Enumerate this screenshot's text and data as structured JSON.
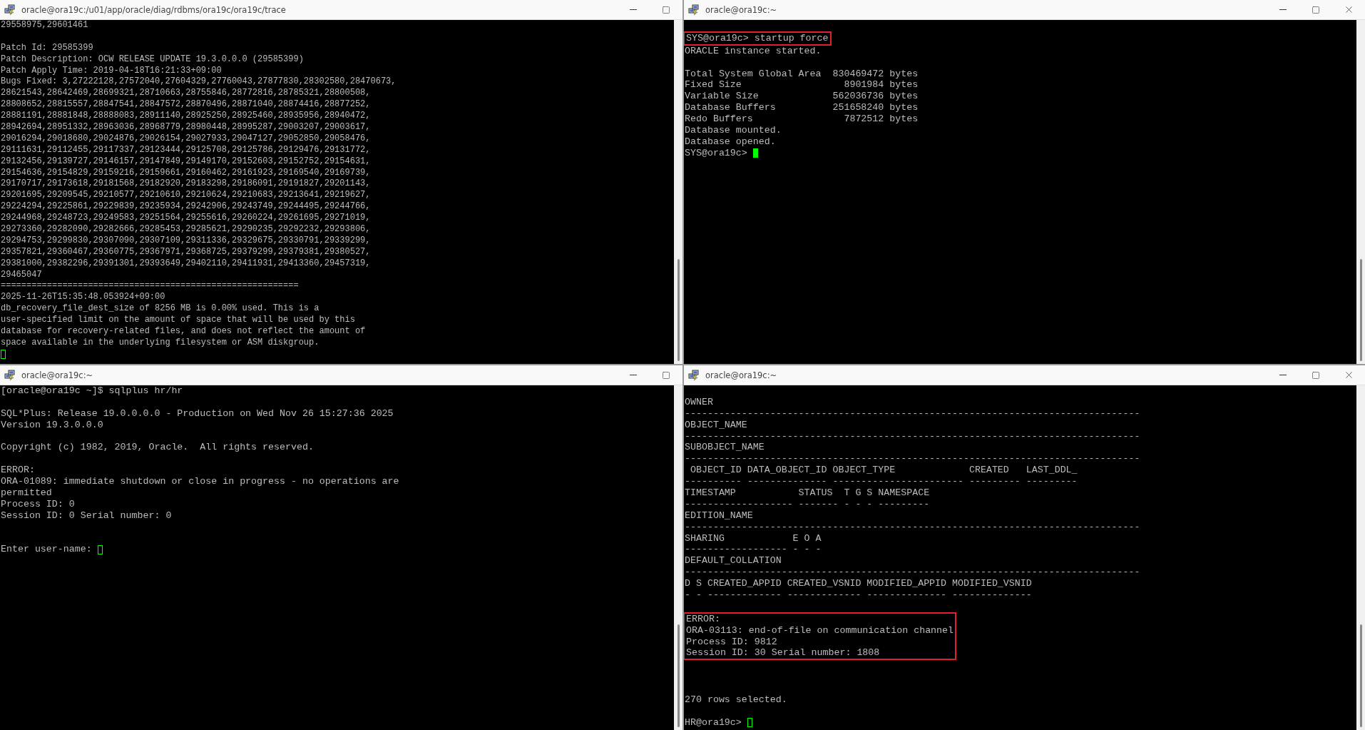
{
  "windows": [
    {
      "title": "oracle@ora19c:/u01/app/oracle/diag/rdbms/ora19c/ora19c/trace",
      "controls": [
        {
          "kind": "minimize"
        },
        {
          "kind": "maximize"
        }
      ],
      "blocks": [
        {
          "kind": "text",
          "lines": [
            "29558975,29601461"
          ]
        },
        {
          "kind": "blank"
        },
        {
          "kind": "text",
          "lines": [
            "Patch Id: 29585399",
            "Patch Description: OCW RELEASE UPDATE 19.3.0.0.0 (29585399)",
            "Patch Apply Time: 2019-04-18T16:21:33+09:00",
            "Bugs Fixed: 3,27222128,27572040,27604329,27760043,27877830,28302580,28470673,",
            "28621543,28642469,28699321,28710663,28755846,28772816,28785321,28800508,",
            "28808652,28815557,28847541,28847572,28870496,28871040,28874416,28877252,",
            "28881191,28881848,28888083,28911140,28925250,28925460,28935956,28940472,",
            "28942694,28951332,28963036,28968779,28980448,28995287,29003207,29003617,",
            "29016294,29018680,29024876,29026154,29027933,29047127,29052850,29058476,",
            "29111631,29112455,29117337,29123444,29125708,29125786,29129476,29131772,",
            "29132456,29139727,29146157,29147849,29149170,29152603,29152752,29154631,",
            "29154636,29154829,29159216,29159661,29160462,29161923,29169540,29169739,",
            "29170717,29173618,29181568,29182920,29183298,29186091,29191827,29201143,",
            "29201695,29209545,29210577,29210610,29210624,29210683,29213641,29219627,",
            "29224294,29225861,29229839,29235934,29242906,29243749,29244495,29244766,",
            "29244968,29248723,29249583,29251564,29255616,29260224,29261695,29271019,",
            "29273360,29282090,29282666,29285453,29285621,29290235,29292232,29293806,",
            "29294753,29299830,29307090,29307109,29311336,29329675,29330791,29339299,",
            "29357821,29360467,29360775,29367971,29368725,29379299,29379381,29380527,",
            "29381000,29382296,29391301,29393649,29402110,29411931,29413360,29457319,",
            "29465047",
            "==========================================================",
            "2025-11-26T15:35:48.053924+09:00",
            "db_recovery_file_dest_size of 8256 MB is 0.00% used. This is a",
            "user-specified limit on the amount of space that will be used by this",
            "database for recovery-related files, and does not reflect the amount of",
            "space available in the underlying filesystem or ASM diskgroup."
          ]
        },
        {
          "kind": "prompt",
          "focused": false
        }
      ]
    },
    {
      "title": "oracle@ora19c:~",
      "controls": [
        {
          "kind": "minimize"
        },
        {
          "kind": "maximize"
        },
        {
          "kind": "close"
        }
      ],
      "blocks": [
        {
          "kind": "blank"
        },
        {
          "kind": "highlight",
          "lines": [
            "SYS@ora19c> startup force"
          ]
        },
        {
          "kind": "text",
          "lines": [
            "ORACLE instance started."
          ]
        },
        {
          "kind": "blank"
        },
        {
          "kind": "text",
          "lines": [
            "Total System Global Area  830469472 bytes",
            "Fixed Size                  8901984 bytes",
            "Variable Size             562036736 bytes",
            "Database Buffers          251658240 bytes",
            "Redo Buffers                7872512 bytes",
            "Database mounted.",
            "Database opened."
          ]
        },
        {
          "kind": "prompt",
          "prompt": "SYS@ora19c>",
          "focused": true
        }
      ]
    },
    {
      "title": "oracle@ora19c:~",
      "controls": [
        {
          "kind": "minimize"
        },
        {
          "kind": "maximize"
        }
      ],
      "blocks": [
        {
          "kind": "text",
          "lines": [
            "[oracle@ora19c ~]$ sqlplus hr/hr"
          ]
        },
        {
          "kind": "blank"
        },
        {
          "kind": "text",
          "lines": [
            "SQL*Plus: Release 19.0.0.0.0 - Production on Wed Nov 26 15:27:36 2025",
            "Version 19.3.0.0.0"
          ]
        },
        {
          "kind": "blank"
        },
        {
          "kind": "text",
          "lines": [
            "Copyright (c) 1982, 2019, Oracle.  All rights reserved."
          ]
        },
        {
          "kind": "blank"
        },
        {
          "kind": "text",
          "lines": [
            "ERROR:",
            "ORA-01089: immediate shutdown or close in progress - no operations are",
            "permitted",
            "Process ID: 0",
            "Session ID: 0 Serial number: 0"
          ]
        },
        {
          "kind": "blank"
        },
        {
          "kind": "blank"
        },
        {
          "kind": "prompt",
          "prompt": "Enter user-name:",
          "focused": false
        }
      ]
    },
    {
      "title": "oracle@ora19c:~",
      "controls": [
        {
          "kind": "minimize"
        },
        {
          "kind": "maximize"
        },
        {
          "kind": "close"
        }
      ],
      "blocks": [
        {
          "kind": "blank"
        },
        {
          "kind": "text",
          "lines": [
            "OWNER",
            "--------------------------------------------------------------------------------",
            "OBJECT_NAME",
            "--------------------------------------------------------------------------------",
            "SUBOBJECT_NAME",
            "--------------------------------------------------------------------------------",
            " OBJECT_ID DATA_OBJECT_ID OBJECT_TYPE             CREATED   LAST_DDL_",
            "---------- -------------- ----------------------- --------- ---------",
            "TIMESTAMP           STATUS  T G S NAMESPACE",
            "------------------- ------- - - - ---------",
            "EDITION_NAME",
            "--------------------------------------------------------------------------------",
            "SHARING            E O A",
            "------------------ - - -",
            "DEFAULT_COLLATION",
            "--------------------------------------------------------------------------------",
            "D S CREATED_APPID CREATED_VSNID MODIFIED_APPID MODIFIED_VSNID",
            "- - ------------- ------------- -------------- --------------"
          ]
        },
        {
          "kind": "blank"
        },
        {
          "kind": "highlight",
          "lines": [
            "ERROR:",
            "ORA-03113: end-of-file on communication channel",
            "Process ID: 9812",
            "Session ID: 30 Serial number: 1808"
          ]
        },
        {
          "kind": "blank"
        },
        {
          "kind": "blank"
        },
        {
          "kind": "blank"
        },
        {
          "kind": "text",
          "lines": [
            "270 rows selected."
          ]
        },
        {
          "kind": "blank"
        },
        {
          "kind": "prompt",
          "prompt": "HR@ora19c>",
          "focused": false
        }
      ]
    }
  ]
}
